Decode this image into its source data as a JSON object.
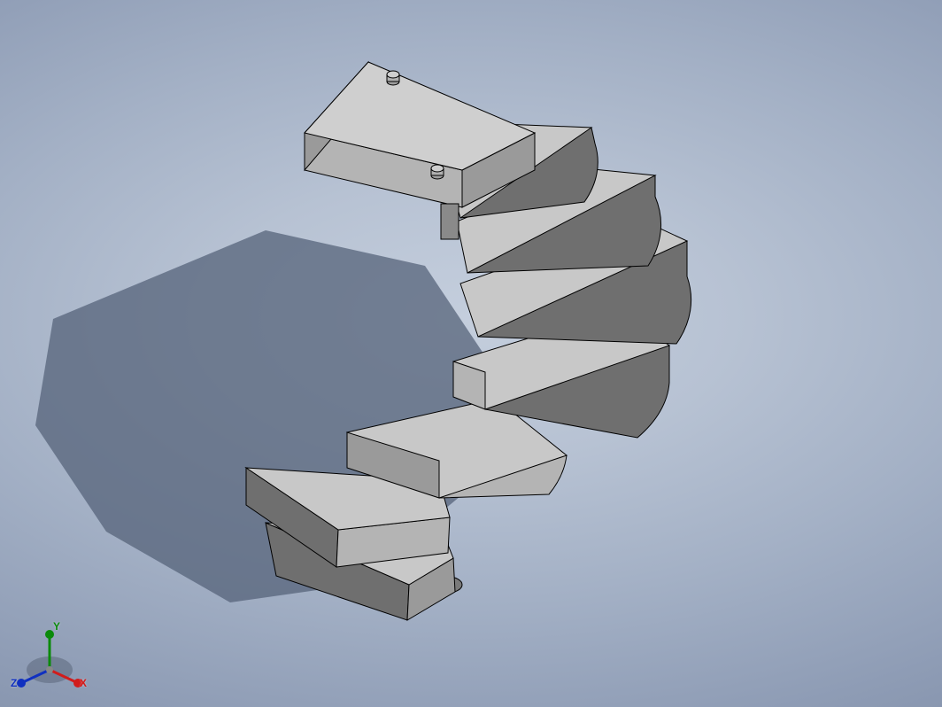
{
  "triad": {
    "x_label": "X",
    "y_label": "Y",
    "z_label": "Z",
    "x_color": "#d11c1c",
    "y_color": "#0a8a0a",
    "z_color": "#1030c0"
  },
  "model": {
    "description": "spiral staircase",
    "material_color_top": "#c8c8c8",
    "material_color_side_light": "#b4b4b4",
    "material_color_side_dark": "#6f6f6f",
    "edge_color": "#000000"
  },
  "shadow": {
    "color": "#55637a"
  }
}
